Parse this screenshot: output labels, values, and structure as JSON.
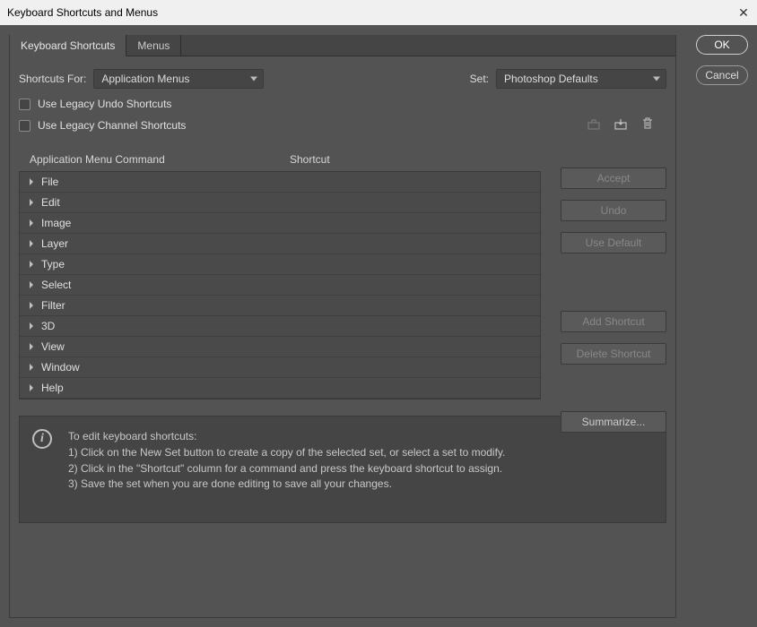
{
  "window": {
    "title": "Keyboard Shortcuts and Menus"
  },
  "tabs": [
    {
      "label": "Keyboard Shortcuts",
      "active": true
    },
    {
      "label": "Menus",
      "active": false
    }
  ],
  "shortcutsFor": {
    "label": "Shortcuts For:",
    "value": "Application Menus"
  },
  "set": {
    "label": "Set:",
    "value": "Photoshop Defaults"
  },
  "legacyUndo": {
    "label": "Use Legacy Undo Shortcuts"
  },
  "legacyChannel": {
    "label": "Use Legacy Channel Shortcuts"
  },
  "columns": {
    "command": "Application Menu Command",
    "shortcut": "Shortcut"
  },
  "menus": [
    {
      "label": "File"
    },
    {
      "label": "Edit"
    },
    {
      "label": "Image"
    },
    {
      "label": "Layer"
    },
    {
      "label": "Type"
    },
    {
      "label": "Select"
    },
    {
      "label": "Filter"
    },
    {
      "label": "3D"
    },
    {
      "label": "View"
    },
    {
      "label": "Window"
    },
    {
      "label": "Help"
    }
  ],
  "sideButtons": {
    "accept": "Accept",
    "undo": "Undo",
    "useDefault": "Use Default",
    "addShortcut": "Add Shortcut",
    "deleteShortcut": "Delete Shortcut",
    "summarize": "Summarize..."
  },
  "info": {
    "heading": "To edit keyboard shortcuts:",
    "line1": "1) Click on the New Set button to create a copy of the selected set, or select a set to modify.",
    "line2": "2) Click in the \"Shortcut\" column for a command and press the keyboard shortcut to assign.",
    "line3": "3) Save the set when you are done editing to save all your changes."
  },
  "dialogButtons": {
    "ok": "OK",
    "cancel": "Cancel"
  }
}
